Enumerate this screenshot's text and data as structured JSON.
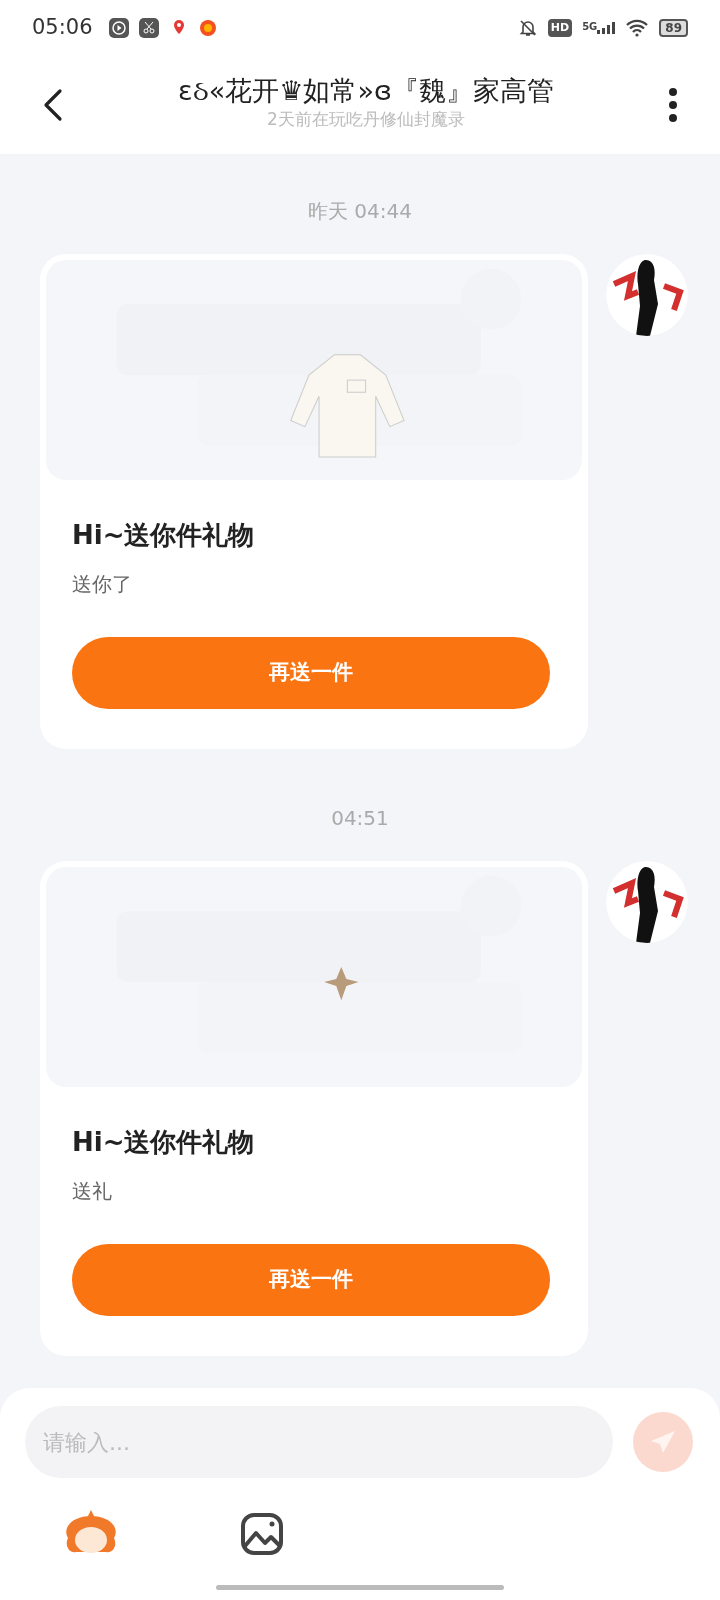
{
  "status_bar": {
    "time": "05:06",
    "hd": "HD",
    "network": "5G",
    "battery": "89"
  },
  "header": {
    "title": "ɛઠ«花开♛如常»ɞ『魏』家高管",
    "subtitle": "2天前在玩吃丹修仙封魔录"
  },
  "messages": [
    {
      "timestamp": "昨天 04:44",
      "card": {
        "title": "Hi~送你件礼物",
        "text": "送你了",
        "button": "再送一件"
      }
    },
    {
      "timestamp": "04:51",
      "card": {
        "title": "Hi~送你件礼物",
        "text": "送礼",
        "button": "再送一件"
      }
    }
  ],
  "composer": {
    "placeholder": "请输入...",
    "send_disabled": true
  }
}
